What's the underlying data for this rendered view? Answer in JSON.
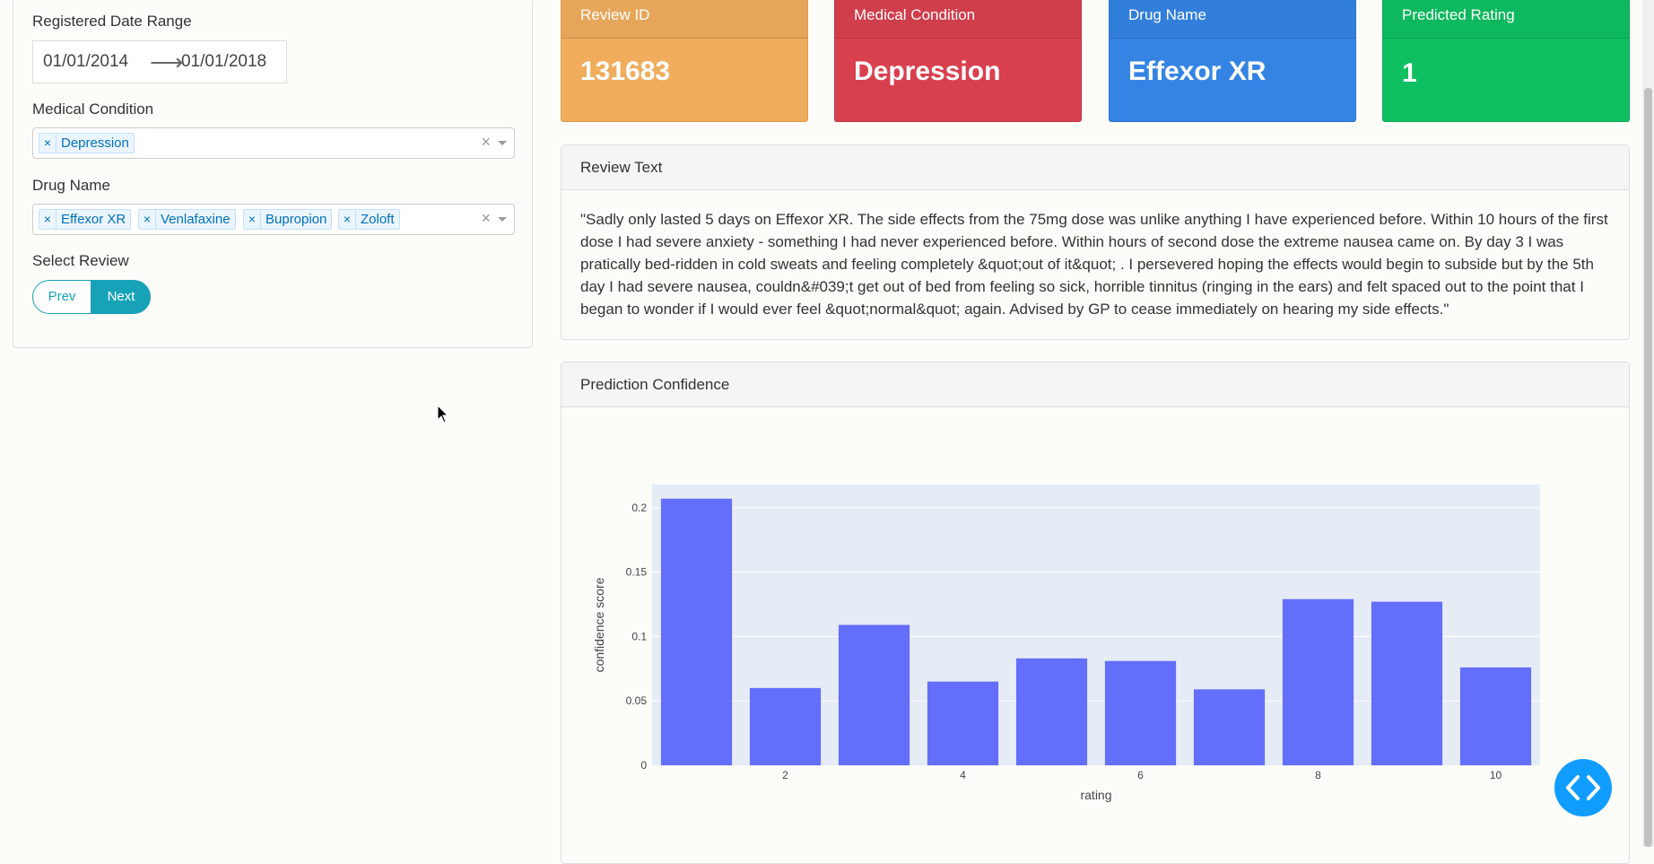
{
  "filters": {
    "date_range_label": "Registered Date Range",
    "start_date": "01/01/2014",
    "end_date": "01/01/2018",
    "arrow": "⟶",
    "medical_condition_label": "Medical Condition",
    "medical_conditions": [
      "Depression"
    ],
    "drug_name_label": "Drug Name",
    "drug_names": [
      "Effexor XR",
      "Venlafaxine",
      "Bupropion",
      "Zoloft"
    ],
    "chip_remove": "×",
    "clear_all": "×",
    "select_review_label": "Select Review",
    "prev_label": "Prev",
    "next_label": "Next"
  },
  "cards": {
    "review_id": {
      "label": "Review ID",
      "value": "131683",
      "color": "#f0ad5e"
    },
    "medical_condition": {
      "label": "Medical Condition",
      "value": "Depression",
      "color": "#d9404f"
    },
    "drug_name": {
      "label": "Drug Name",
      "value": "Effexor XR",
      "color": "#3584e4"
    },
    "predicted_rating": {
      "label": "Predicted Rating",
      "value": "1",
      "color": "#0fc062"
    }
  },
  "review": {
    "title": "Review Text",
    "text": "\"Sadly only lasted 5 days on Effexor XR. The side effects from the 75mg dose was unlike anything I have experienced before. Within 10 hours of the first dose I had severe anxiety - something I had never experienced before. Within hours of second dose the extreme nausea came on. By day 3 I was pratically bed-ridden in cold sweats and feeling completely &quot;out of it&quot; . I persevered hoping the effects would begin to subside but by the 5th day I had severe nausea, couldn&#039;t get out of bed from feeling so sick, horrible tinnitus (ringing in the ears) and felt spaced out to the point that I began to wonder if I would ever feel &quot;normal&quot; again. Advised by GP to cease immediately on hearing my side effects.\""
  },
  "prediction": {
    "title": "Prediction Confidence"
  },
  "chart_data": {
    "type": "bar",
    "x": [
      1,
      2,
      3,
      4,
      5,
      6,
      7,
      8,
      9,
      10
    ],
    "values": [
      0.207,
      0.06,
      0.109,
      0.065,
      0.083,
      0.081,
      0.059,
      0.129,
      0.127,
      0.076
    ],
    "xlabel": "rating",
    "ylabel": "confidence score",
    "xticks": [
      "2",
      "4",
      "6",
      "8",
      "10"
    ],
    "xtick_values": [
      2,
      4,
      6,
      8,
      10
    ],
    "yticks": [
      "0",
      "0.05",
      "0.1",
      "0.15",
      "0.2"
    ],
    "ytick_values": [
      0,
      0.05,
      0.1,
      0.15,
      0.2
    ],
    "ylim": [
      0,
      0.218
    ],
    "xlim": [
      0.5,
      10.5
    ],
    "bar_color": "#636efa",
    "plot_bg": "#e5ecf6",
    "grid": true
  },
  "icons": {
    "code_toggle": "code-icon",
    "cursor": "mouse-pointer-icon"
  }
}
